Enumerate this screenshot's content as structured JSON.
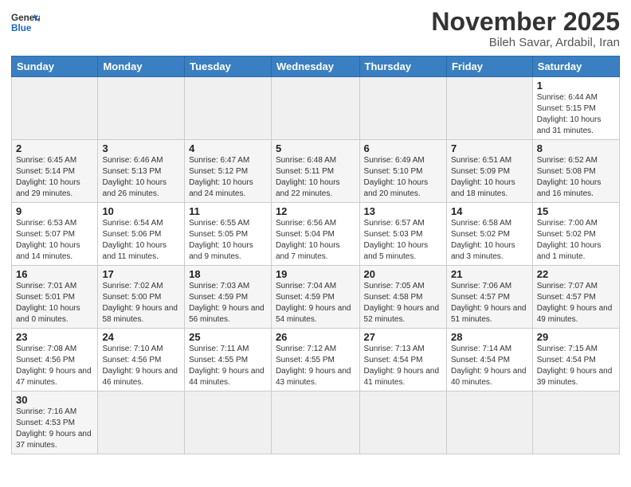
{
  "logo": {
    "general": "General",
    "blue": "Blue"
  },
  "title": "November 2025",
  "location": "Bileh Savar, Ardabil, Iran",
  "days_of_week": [
    "Sunday",
    "Monday",
    "Tuesday",
    "Wednesday",
    "Thursday",
    "Friday",
    "Saturday"
  ],
  "weeks": [
    [
      {
        "day": "",
        "info": ""
      },
      {
        "day": "",
        "info": ""
      },
      {
        "day": "",
        "info": ""
      },
      {
        "day": "",
        "info": ""
      },
      {
        "day": "",
        "info": ""
      },
      {
        "day": "",
        "info": ""
      },
      {
        "day": "1",
        "info": "Sunrise: 6:44 AM\nSunset: 5:15 PM\nDaylight: 10 hours and 31 minutes."
      }
    ],
    [
      {
        "day": "2",
        "info": "Sunrise: 6:45 AM\nSunset: 5:14 PM\nDaylight: 10 hours and 29 minutes."
      },
      {
        "day": "3",
        "info": "Sunrise: 6:46 AM\nSunset: 5:13 PM\nDaylight: 10 hours and 26 minutes."
      },
      {
        "day": "4",
        "info": "Sunrise: 6:47 AM\nSunset: 5:12 PM\nDaylight: 10 hours and 24 minutes."
      },
      {
        "day": "5",
        "info": "Sunrise: 6:48 AM\nSunset: 5:11 PM\nDaylight: 10 hours and 22 minutes."
      },
      {
        "day": "6",
        "info": "Sunrise: 6:49 AM\nSunset: 5:10 PM\nDaylight: 10 hours and 20 minutes."
      },
      {
        "day": "7",
        "info": "Sunrise: 6:51 AM\nSunset: 5:09 PM\nDaylight: 10 hours and 18 minutes."
      },
      {
        "day": "8",
        "info": "Sunrise: 6:52 AM\nSunset: 5:08 PM\nDaylight: 10 hours and 16 minutes."
      }
    ],
    [
      {
        "day": "9",
        "info": "Sunrise: 6:53 AM\nSunset: 5:07 PM\nDaylight: 10 hours and 14 minutes."
      },
      {
        "day": "10",
        "info": "Sunrise: 6:54 AM\nSunset: 5:06 PM\nDaylight: 10 hours and 11 minutes."
      },
      {
        "day": "11",
        "info": "Sunrise: 6:55 AM\nSunset: 5:05 PM\nDaylight: 10 hours and 9 minutes."
      },
      {
        "day": "12",
        "info": "Sunrise: 6:56 AM\nSunset: 5:04 PM\nDaylight: 10 hours and 7 minutes."
      },
      {
        "day": "13",
        "info": "Sunrise: 6:57 AM\nSunset: 5:03 PM\nDaylight: 10 hours and 5 minutes."
      },
      {
        "day": "14",
        "info": "Sunrise: 6:58 AM\nSunset: 5:02 PM\nDaylight: 10 hours and 3 minutes."
      },
      {
        "day": "15",
        "info": "Sunrise: 7:00 AM\nSunset: 5:02 PM\nDaylight: 10 hours and 1 minute."
      }
    ],
    [
      {
        "day": "16",
        "info": "Sunrise: 7:01 AM\nSunset: 5:01 PM\nDaylight: 10 hours and 0 minutes."
      },
      {
        "day": "17",
        "info": "Sunrise: 7:02 AM\nSunset: 5:00 PM\nDaylight: 9 hours and 58 minutes."
      },
      {
        "day": "18",
        "info": "Sunrise: 7:03 AM\nSunset: 4:59 PM\nDaylight: 9 hours and 56 minutes."
      },
      {
        "day": "19",
        "info": "Sunrise: 7:04 AM\nSunset: 4:59 PM\nDaylight: 9 hours and 54 minutes."
      },
      {
        "day": "20",
        "info": "Sunrise: 7:05 AM\nSunset: 4:58 PM\nDaylight: 9 hours and 52 minutes."
      },
      {
        "day": "21",
        "info": "Sunrise: 7:06 AM\nSunset: 4:57 PM\nDaylight: 9 hours and 51 minutes."
      },
      {
        "day": "22",
        "info": "Sunrise: 7:07 AM\nSunset: 4:57 PM\nDaylight: 9 hours and 49 minutes."
      }
    ],
    [
      {
        "day": "23",
        "info": "Sunrise: 7:08 AM\nSunset: 4:56 PM\nDaylight: 9 hours and 47 minutes."
      },
      {
        "day": "24",
        "info": "Sunrise: 7:10 AM\nSunset: 4:56 PM\nDaylight: 9 hours and 46 minutes."
      },
      {
        "day": "25",
        "info": "Sunrise: 7:11 AM\nSunset: 4:55 PM\nDaylight: 9 hours and 44 minutes."
      },
      {
        "day": "26",
        "info": "Sunrise: 7:12 AM\nSunset: 4:55 PM\nDaylight: 9 hours and 43 minutes."
      },
      {
        "day": "27",
        "info": "Sunrise: 7:13 AM\nSunset: 4:54 PM\nDaylight: 9 hours and 41 minutes."
      },
      {
        "day": "28",
        "info": "Sunrise: 7:14 AM\nSunset: 4:54 PM\nDaylight: 9 hours and 40 minutes."
      },
      {
        "day": "29",
        "info": "Sunrise: 7:15 AM\nSunset: 4:54 PM\nDaylight: 9 hours and 39 minutes."
      }
    ],
    [
      {
        "day": "30",
        "info": "Sunrise: 7:16 AM\nSunset: 4:53 PM\nDaylight: 9 hours and 37 minutes."
      },
      {
        "day": "",
        "info": ""
      },
      {
        "day": "",
        "info": ""
      },
      {
        "day": "",
        "info": ""
      },
      {
        "day": "",
        "info": ""
      },
      {
        "day": "",
        "info": ""
      },
      {
        "day": "",
        "info": ""
      }
    ]
  ]
}
